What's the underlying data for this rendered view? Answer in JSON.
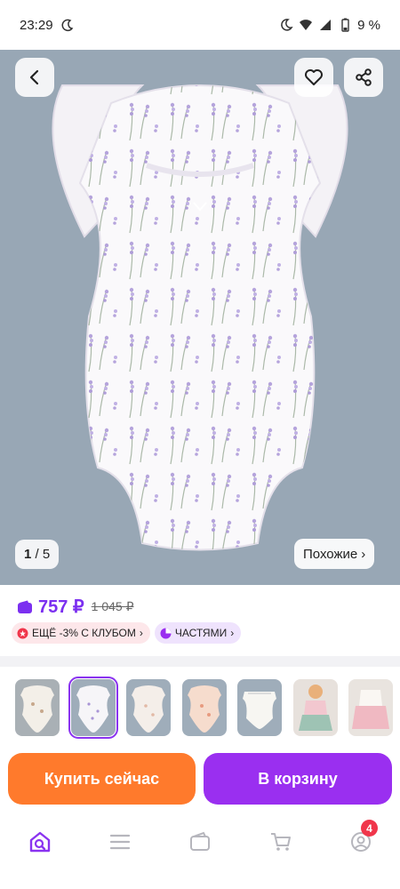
{
  "status_bar": {
    "time": "23:29",
    "battery": "9 %"
  },
  "hero": {
    "counter_current": "1",
    "counter_total": "5",
    "similar_label": "Похожие",
    "similar_chevron": "›"
  },
  "price": {
    "current": "757 ₽",
    "old": "1 045 ₽",
    "wallet_icon": "wallet-icon"
  },
  "chips": [
    {
      "label": "ЕЩЁ -3% С КЛУБОМ",
      "icon": "club-icon",
      "chevron": "›"
    },
    {
      "label": "ЧАСТЯМИ",
      "icon": "installments-icon",
      "chevron": "›"
    }
  ],
  "thumbnails": {
    "count": 7,
    "selected_index": 1
  },
  "actions": {
    "buy_now": "Купить сейчас",
    "add_to_cart": "В корзину"
  },
  "bottom_nav": {
    "cart_badge": "4",
    "items": [
      "home-search-icon",
      "catalog-icon",
      "wallet-icon",
      "cart-icon",
      "profile-icon"
    ]
  },
  "colors": {
    "brand_purple": "#9a2ff0",
    "price_purple": "#7b2ff0",
    "buy_orange": "#ff7a2c",
    "badge_red": "#f0364b",
    "hero_background": "#98a7b5"
  }
}
